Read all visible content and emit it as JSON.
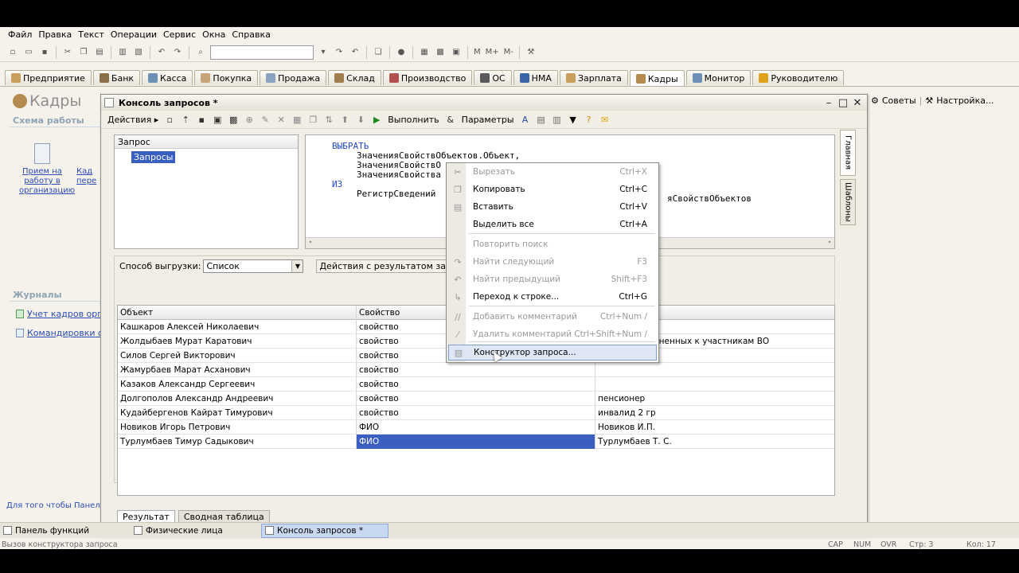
{
  "menu": [
    "Файл",
    "Правка",
    "Текст",
    "Операции",
    "Сервис",
    "Окна",
    "Справка"
  ],
  "toolbar": {
    "extra": [
      "M",
      "M+",
      "M-"
    ]
  },
  "tabs": [
    "Предприятие",
    "Банк",
    "Касса",
    "Покупка",
    "Продажа",
    "Склад",
    "Производство",
    "ОС",
    "НМА",
    "Зарплата",
    "Кадры",
    "Монитор",
    "Руководителю"
  ],
  "active_tab_index": 10,
  "left": {
    "title": "Кадры",
    "scheme_title": "Схема работы",
    "scheme_item_1": "Прием на работу в организацию",
    "scheme_item_2": "Кад пере",
    "journals_title": "Журналы",
    "journal_1": "Учет кадров орган",
    "journal_2": "Командировки орг",
    "hint": "Для того чтобы Панель"
  },
  "right_links": {
    "tips": "Советы",
    "settings": "Настройка..."
  },
  "window": {
    "title": "Консоль запросов *",
    "actions": "Действия",
    "run": "Выполнить",
    "params": "Параметры",
    "tree_header": "Запрос",
    "tree_item": "Запросы",
    "code": [
      {
        "text": "ВЫБРАТЬ",
        "kw": true,
        "indent": 0
      },
      {
        "text": "ЗначенияСвойствОбъектов.Объект,",
        "kw": false,
        "indent": 1
      },
      {
        "text": "ЗначенияСвойствО",
        "kw": false,
        "indent": 1
      },
      {
        "text": "ЗначенияСвойства",
        "kw": false,
        "indent": 1
      },
      {
        "text": "ИЗ",
        "kw": true,
        "indent": 0
      },
      {
        "text": "РегистрСведений",
        "kw": false,
        "indent": 1
      }
    ],
    "code_tail": "яСвойствОбъектов",
    "side_tabs": [
      "Главная",
      "Шаблоны"
    ],
    "export_label": "Способ выгрузки:",
    "export_value": "Список",
    "result_actions": "Действия с результатом запроса",
    "columns": [
      "Объект",
      "Свойство",
      ""
    ],
    "rows": [
      {
        "obj": "Кашкаров Алексей Николаевич",
        "prop": "свойство",
        "val": ""
      },
      {
        "obj": "Жолдыбаев Мурат Каратович",
        "prop": "свойство",
        "val": "я лиц, приравненных к участникам ВО"
      },
      {
        "obj": "Силов Сергей Викторович",
        "prop": "свойство",
        "val": ""
      },
      {
        "obj": "Жамурбаев Марат Асханович",
        "prop": "свойство",
        "val": ""
      },
      {
        "obj": "Казаков Александр Сергеевич",
        "prop": "свойство",
        "val": ""
      },
      {
        "obj": "Долгополов Александр Андреевич",
        "prop": "свойство",
        "val": "пенсионер"
      },
      {
        "obj": "Кудайбергенов Кайрат Тимурович",
        "prop": "свойство",
        "val": "инвалид 2 гр"
      },
      {
        "obj": "Новиков Игорь Петрович",
        "prop": "ФИО",
        "val": "Новиков И.П."
      },
      {
        "obj": "Турлумбаев Тимур Садыкович",
        "prop": "ФИО",
        "val": "Турлумбаев Т. С."
      }
    ],
    "selected_row": 8,
    "bottom_tabs": [
      "Результат",
      "Сводная таблица"
    ]
  },
  "context_menu": [
    {
      "label": "Вырезать",
      "shortcut": "Ctrl+X",
      "disabled": true,
      "icon": "scissors-icon"
    },
    {
      "label": "Копировать",
      "shortcut": "Ctrl+C",
      "disabled": false,
      "icon": "copy-icon"
    },
    {
      "label": "Вставить",
      "shortcut": "Ctrl+V",
      "disabled": false,
      "icon": "paste-icon"
    },
    {
      "label": "Выделить все",
      "shortcut": "Ctrl+A",
      "disabled": false,
      "icon": ""
    },
    {
      "label": "Повторить поиск",
      "shortcut": "",
      "disabled": true,
      "icon": ""
    },
    {
      "label": "Найти следующий",
      "shortcut": "F3",
      "disabled": true,
      "icon": "find-next-icon"
    },
    {
      "label": "Найти предыдущий",
      "shortcut": "Shift+F3",
      "disabled": true,
      "icon": "find-prev-icon"
    },
    {
      "label": "Переход к строке...",
      "shortcut": "Ctrl+G",
      "disabled": false,
      "icon": "goto-line-icon"
    },
    {
      "label": "Добавить комментарий",
      "shortcut": "Ctrl+Num /",
      "disabled": true,
      "icon": "comment-icon"
    },
    {
      "label": "Удалить комментарий",
      "shortcut": "Ctrl+Shift+Num /",
      "disabled": true,
      "icon": "uncomment-icon"
    },
    {
      "label": "Конструктор запроса...",
      "shortcut": "",
      "disabled": false,
      "icon": "query-builder-icon"
    }
  ],
  "taskbar": [
    "Панель функций",
    "Физические лица",
    "Консоль запросов *"
  ],
  "status": {
    "text": "Вызов конструктора запроса",
    "cap": "CAP",
    "num": "NUM",
    "ovr": "OVR",
    "line": "Стр: 3",
    "col": "Кол: 17"
  }
}
